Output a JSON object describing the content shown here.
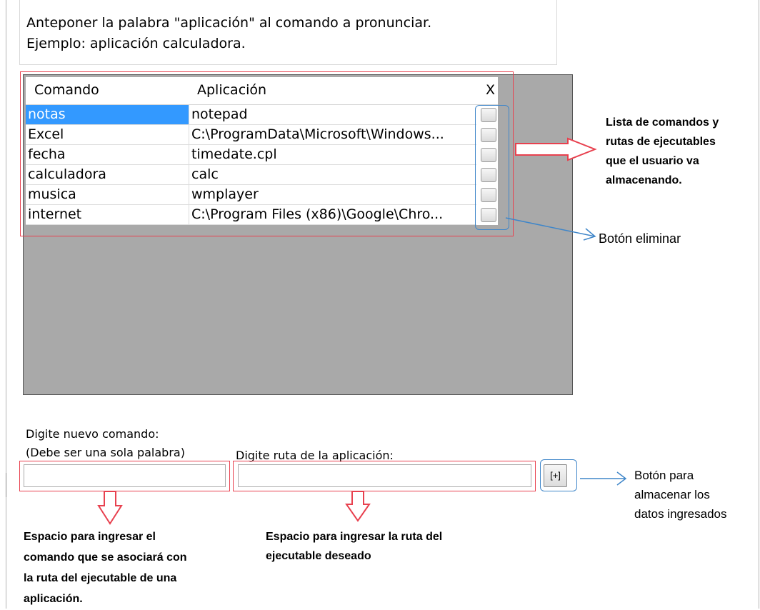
{
  "instructions": {
    "line1": "Anteponer la palabra \"aplicación\" al comando a pronunciar.",
    "line2": "Ejemplo: aplicación calculadora."
  },
  "grid": {
    "headers": {
      "command": "Comando",
      "application": "Aplicación",
      "delete": "X"
    },
    "rows": [
      {
        "command": "notas",
        "application": "notepad",
        "selected": true
      },
      {
        "command": "Excel",
        "application": "C:\\ProgramData\\Microsoft\\Windows...",
        "selected": false
      },
      {
        "command": "fecha",
        "application": "timedate.cpl",
        "selected": false
      },
      {
        "command": "calculadora",
        "application": "calc",
        "selected": false
      },
      {
        "command": "musica",
        "application": "wmplayer",
        "selected": false
      },
      {
        "command": "internet",
        "application": "C:\\Program Files (x86)\\Google\\Chro...",
        "selected": false
      }
    ]
  },
  "form": {
    "command_label_1": "Digite nuevo comando:",
    "command_label_2": "(Debe ser una sola palabra)",
    "path_label": "Digite ruta de la aplicación:",
    "command_value": "",
    "path_value": "",
    "add_button_label": "[+]"
  },
  "annotations": {
    "list_lines": [
      "Lista de comandos y",
      "rutas de ejecutables",
      "que el usuario va",
      "almacenando."
    ],
    "delete_button": "Botón eliminar",
    "add_button_lines": [
      "Botón para",
      "almacenar los",
      "datos ingresados"
    ],
    "command_space_lines": [
      "Espacio para ingresar el",
      "comando que se asociará con",
      "la ruta del ejecutable de una",
      "aplicación."
    ],
    "path_space_lines": [
      "Espacio para ingresar la ruta del",
      "ejecutable deseado"
    ]
  },
  "colors": {
    "highlight_red": "#e8414f",
    "highlight_blue": "#3f86c9",
    "selection": "#3399ff",
    "grid_background": "#a9a9a9"
  }
}
